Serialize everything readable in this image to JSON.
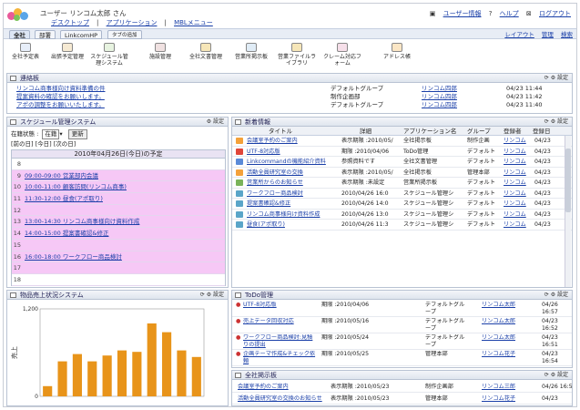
{
  "header": {
    "user": "ユーザー リンコム太郎 さん",
    "nav": [
      "デスクトップ",
      "アプリケーション",
      "MBLメニュー"
    ],
    "links": [
      "ユーザー情報",
      "ヘルプ",
      "ログアウト"
    ]
  },
  "tabs": [
    {
      "label": "全社"
    },
    {
      "label": "部署"
    },
    {
      "label": "LinkcomHP"
    },
    {
      "label": "タブの追加"
    }
  ],
  "tab_actions": [
    "レイアウト",
    "管理",
    "検索"
  ],
  "apps": [
    "全社予定表",
    "出張予定管理",
    "スケジュール管理システム",
    "施設管理",
    "全社文書管理",
    "営業所掲示板",
    "営業ファイルライブラリ",
    "クレーム対応フォーム",
    "アドレス帳"
  ],
  "contact": {
    "title": "連絡板",
    "rows": [
      {
        "msg": "リンコム商事様向け資料準備の件",
        "group": "デフォルトグループ",
        "user": "リンコム四郎",
        "date": "04/23 11:44"
      },
      {
        "msg": "提案資料の確認をお願いします。",
        "group": "制作企画部",
        "user": "リンコム四郎",
        "date": "04/23 11:42"
      },
      {
        "msg": "アポの調整をお願いいたします。",
        "group": "デフォルトグループ",
        "user": "リンコム四郎",
        "date": "04/23 11:40"
      }
    ]
  },
  "schedule": {
    "title": "スケジュール管理システム",
    "filter_label": "在籍状態 :",
    "filter_value": "在籍",
    "update_btn": "更新",
    "nav": "[前の日] [今日] [次の日]",
    "day_header": "2010年04月26日(今日)の予定",
    "hours": [
      {
        "h": "8",
        "text": "",
        "ev": false
      },
      {
        "h": "9",
        "text": "09:00-09:00 営業部内会議",
        "ev": true
      },
      {
        "h": "10",
        "text": "10:00-11:00 顧客訪問(リンコム商事)",
        "ev": true
      },
      {
        "h": "11",
        "text": "11:30-12:00 昼食(アポ取り)",
        "ev": true
      },
      {
        "h": "12",
        "text": "",
        "ev": true
      },
      {
        "h": "13",
        "text": "13:00-14:30 リンコム商事様向け資料作成",
        "ev": true
      },
      {
        "h": "14",
        "text": "14:00-15:00 提案書確認&修正",
        "ev": true
      },
      {
        "h": "15",
        "text": "",
        "ev": true
      },
      {
        "h": "16",
        "text": "16:00-18:00 ワークフロー商品検討",
        "ev": true
      },
      {
        "h": "17",
        "text": "",
        "ev": true
      },
      {
        "h": "18",
        "text": "",
        "ev": false
      }
    ]
  },
  "info": {
    "title": "新着情報",
    "cols": [
      "タイトル",
      "詳細",
      "アプリケーション名",
      "グループ",
      "登録者",
      "登録日"
    ],
    "rows": [
      {
        "t": "会議室予約のご案内",
        "d": "表示期限 :2010/05/",
        "a": "全社掲示板",
        "g": "制作企画",
        "u": "リンコム",
        "dt": "04/23"
      },
      {
        "t": "UTF-8対応版",
        "d": "期限 :2010/04/06",
        "a": "ToDo管理",
        "g": "デフォルト",
        "u": "リンコム",
        "dt": "04/23"
      },
      {
        "t": "Linkcommandの機能紹介資料",
        "d": "参照資料です",
        "a": "全社文書管理",
        "g": "デフォルト",
        "u": "リンコム",
        "dt": "04/23"
      },
      {
        "t": "活動全員研究室の交換",
        "d": "表示期限 :2010/05/",
        "a": "全社掲示板",
        "g": "管理本部",
        "u": "リンコム",
        "dt": "04/23"
      },
      {
        "t": "営業所からのお知らせ",
        "d": "表示期限 :未設定",
        "a": "営業所掲示板",
        "g": "デフォルト",
        "u": "リンコム",
        "dt": "04/23"
      },
      {
        "t": "ワークフロー商品検討",
        "d": "2010/04/26 16:0",
        "a": "スケジュール管理シ",
        "g": "デフォルト",
        "u": "リンコム",
        "dt": "04/23"
      },
      {
        "t": "提案書確認&修正",
        "d": "2010/04/26 14:0",
        "a": "スケジュール管理シ",
        "g": "デフォルト",
        "u": "リンコム",
        "dt": "04/23"
      },
      {
        "t": "リンコム商事様向け資料作成",
        "d": "2010/04/26 13:0",
        "a": "スケジュール管理シ",
        "g": "デフォルト",
        "u": "リンコム",
        "dt": "04/23"
      },
      {
        "t": "昼食(アポ取り)",
        "d": "2010/04/26 11:3",
        "a": "スケジュール管理シ",
        "g": "デフォルト",
        "u": "リンコム",
        "dt": "04/23"
      }
    ]
  },
  "sales": {
    "title": "物品売上状況システム",
    "ylabel": "売上",
    "chart_data": {
      "type": "bar",
      "ylim": [
        0,
        1200
      ],
      "yticks": [
        0,
        1200
      ],
      "values": [
        140,
        480,
        580,
        480,
        560,
        630,
        610,
        1000,
        880,
        630,
        540
      ],
      "color": "#e8941a"
    }
  },
  "todo": {
    "title": "ToDo管理",
    "rows": [
      {
        "t": "UTF-8対応版",
        "d": "期限 :2010/04/06",
        "g": "デフォルトグループ",
        "u": "リンコム太郎",
        "dt": "04/26 16:57"
      },
      {
        "t": "売上データ回収対応",
        "d": "期限 :2010/05/16",
        "g": "デフォルトグループ",
        "u": "リンコム太郎",
        "dt": "04/23 16:52"
      },
      {
        "t": "ワークフロー商品検討:見積りの提出",
        "d": "期限 :2010/05/24",
        "g": "デフォルトグループ",
        "u": "リンコム太郎",
        "dt": "04/23 16:51"
      },
      {
        "t": "企画テーマ作成&チェック依頼",
        "d": "期限 :2010/05/25",
        "g": "管理本部",
        "u": "リンコム花子",
        "dt": "04/23 16:54"
      }
    ]
  },
  "board": {
    "title": "全社掲示板",
    "rows": [
      {
        "t": "会議室予約のご案内",
        "d": "表示期限 :2010/05/23",
        "g": "制作企画部",
        "u": "リンコム三郎",
        "dt": "04/26 16:58"
      },
      {
        "t": "活動全員研究室の交換のお知らせ",
        "d": "表示期限 :2010/05/23",
        "g": "管理本部",
        "u": "リンコム花子",
        "dt": "04/23"
      }
    ]
  }
}
